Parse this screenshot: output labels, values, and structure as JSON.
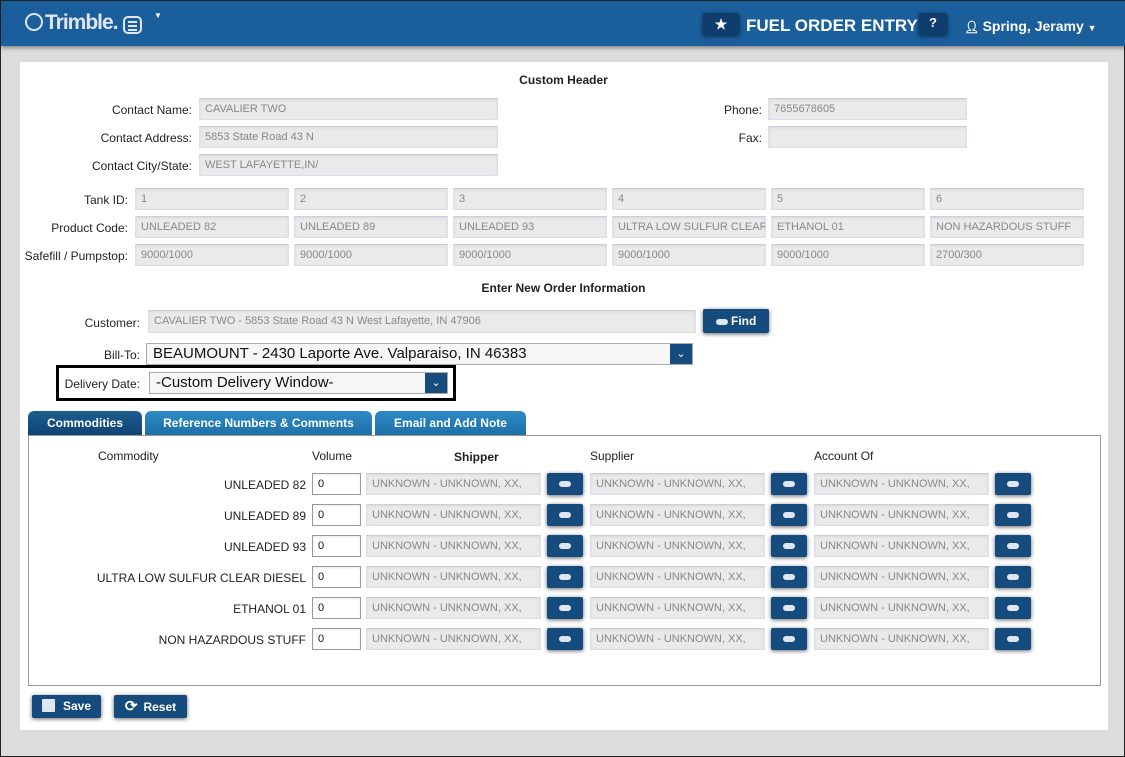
{
  "header": {
    "logo": "Trimble.",
    "title": "FUEL ORDER ENTRY",
    "help": "?",
    "user": "Spring, Jeramy"
  },
  "custom_header": {
    "title": "Custom Header",
    "contact_name_label": "Contact Name:",
    "contact_name": "CAVALIER TWO",
    "contact_address_label": "Contact Address:",
    "contact_address": "5853 State Road 43 N",
    "contact_city_label": "Contact City/State:",
    "contact_city": "WEST LAFAYETTE,IN/",
    "phone_label": "Phone:",
    "phone": "7655678605",
    "fax_label": "Fax:",
    "fax": ""
  },
  "tanks": {
    "labels": [
      "Tank ID:",
      "Product Code:",
      "Safefill / Pumpstop:"
    ],
    "rows": [
      [
        "1",
        "2",
        "3",
        "4",
        "5",
        "6"
      ],
      [
        "UNLEADED 82",
        "UNLEADED 89",
        "UNLEADED 93",
        "ULTRA LOW SULFUR CLEAR DIESEL",
        "ETHANOL 01",
        "NON HAZARDOUS STUFF"
      ],
      [
        "9000/1000",
        "9000/1000",
        "9000/1000",
        "9000/1000",
        "9000/1000",
        "2700/300"
      ]
    ]
  },
  "order": {
    "title": "Enter New Order Information",
    "customer_label": "Customer:",
    "customer": "CAVALIER TWO - 5853 State Road 43 N West Lafayette, IN 47906",
    "find": "Find",
    "billto_label": "Bill-To:",
    "billto": "BEAUMOUNT - 2430 Laporte Ave. Valparaiso, IN 46383",
    "delivery_label": "Delivery Date:",
    "delivery": "-Custom Delivery Window-"
  },
  "tabs": [
    "Commodities",
    "Reference Numbers & Comments",
    "Email and Add Note"
  ],
  "commodities": {
    "headers": {
      "commodity": "Commodity",
      "volume": "Volume",
      "shipper": "Shipper",
      "supplier": "Supplier",
      "account_of": "Account Of"
    },
    "rows": [
      {
        "name": "UNLEADED 82",
        "volume": "0",
        "shipper": "UNKNOWN -  UNKNOWN, XX,",
        "supplier": "UNKNOWN -  UNKNOWN, XX,",
        "account_of": "UNKNOWN -  UNKNOWN, XX,"
      },
      {
        "name": "UNLEADED 89",
        "volume": "0",
        "shipper": "UNKNOWN -  UNKNOWN, XX,",
        "supplier": "UNKNOWN -  UNKNOWN, XX,",
        "account_of": "UNKNOWN -  UNKNOWN, XX,"
      },
      {
        "name": "UNLEADED 93",
        "volume": "0",
        "shipper": "UNKNOWN -  UNKNOWN, XX,",
        "supplier": "UNKNOWN -  UNKNOWN, XX,",
        "account_of": "UNKNOWN -  UNKNOWN, XX,"
      },
      {
        "name": "ULTRA LOW SULFUR CLEAR DIESEL",
        "volume": "0",
        "shipper": "UNKNOWN -  UNKNOWN, XX,",
        "supplier": "UNKNOWN -  UNKNOWN, XX,",
        "account_of": "UNKNOWN -  UNKNOWN, XX,"
      },
      {
        "name": "ETHANOL 01",
        "volume": "0",
        "shipper": "UNKNOWN -  UNKNOWN, XX,",
        "supplier": "UNKNOWN -  UNKNOWN, XX,",
        "account_of": "UNKNOWN -  UNKNOWN, XX,"
      },
      {
        "name": "NON HAZARDOUS STUFF",
        "volume": "0",
        "shipper": "UNKNOWN -  UNKNOWN, XX,",
        "supplier": "UNKNOWN -  UNKNOWN, XX,",
        "account_of": "UNKNOWN -  UNKNOWN, XX,"
      }
    ]
  },
  "actions": {
    "save": "Save",
    "reset": "Reset"
  }
}
